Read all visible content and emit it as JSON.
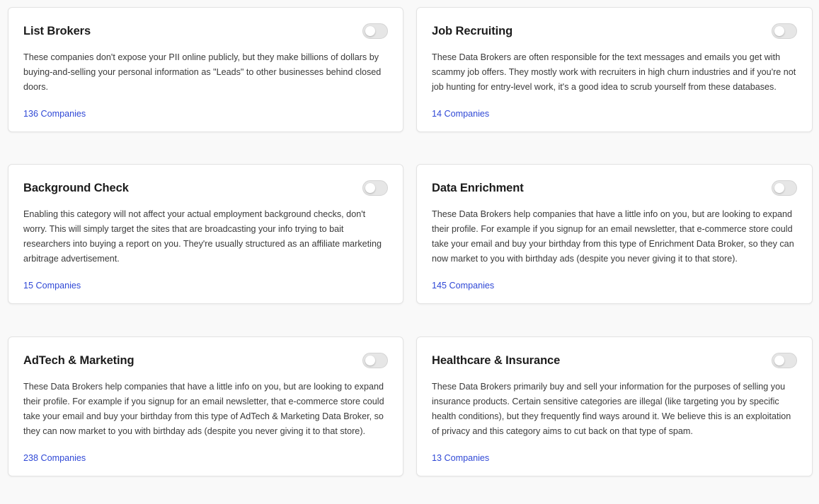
{
  "accent_color": "#2f48d6",
  "categories": [
    {
      "title": "List Brokers",
      "description": "These companies don't expose your PII online publicly, but they make billions of dollars by buying-and-selling your personal information as \"Leads\" to other businesses behind closed doors.",
      "companies_label": "136 Companies",
      "enabled": false
    },
    {
      "title": "Job Recruiting",
      "description": "These Data Brokers are often responsible for the text messages and emails you get with scammy job offers. They mostly work with recruiters in high churn industries and if you're not job hunting for entry-level work, it's a good idea to scrub yourself from these databases.",
      "companies_label": "14 Companies",
      "enabled": false
    },
    {
      "title": "Background Check",
      "description": "Enabling this category will not affect your actual employment background checks, don't worry. This will simply target the sites that are broadcasting your info trying to bait researchers into buying a report on you. They're usually structured as an affiliate marketing arbitrage advertisement.",
      "companies_label": "15 Companies",
      "enabled": false
    },
    {
      "title": "Data Enrichment",
      "description": "These Data Brokers help companies that have a little info on you, but are looking to expand their profile. For example if you signup for an email newsletter, that e-commerce store could take your email and buy your birthday from this type of Enrichment Data Broker, so they can now market to you with birthday ads (despite you never giving it to that store).",
      "companies_label": "145 Companies",
      "enabled": false
    },
    {
      "title": "AdTech & Marketing",
      "description": "These Data Brokers help companies that have a little info on you, but are looking to expand their profile. For example if you signup for an email newsletter, that e-commerce store could take your email and buy your birthday from this type of AdTech & Marketing Data Broker, so they can now market to you with birthday ads (despite you never giving it to that store).",
      "companies_label": "238 Companies",
      "enabled": false
    },
    {
      "title": "Healthcare & Insurance",
      "description": "These Data Brokers primarily buy and sell your information for the purposes of selling you insurance products. Certain sensitive categories are illegal (like targeting you by specific health conditions), but they frequently find ways around it. We believe this is an exploitation of privacy and this category aims to cut back on that type of spam.",
      "companies_label": "13 Companies",
      "enabled": false
    }
  ]
}
